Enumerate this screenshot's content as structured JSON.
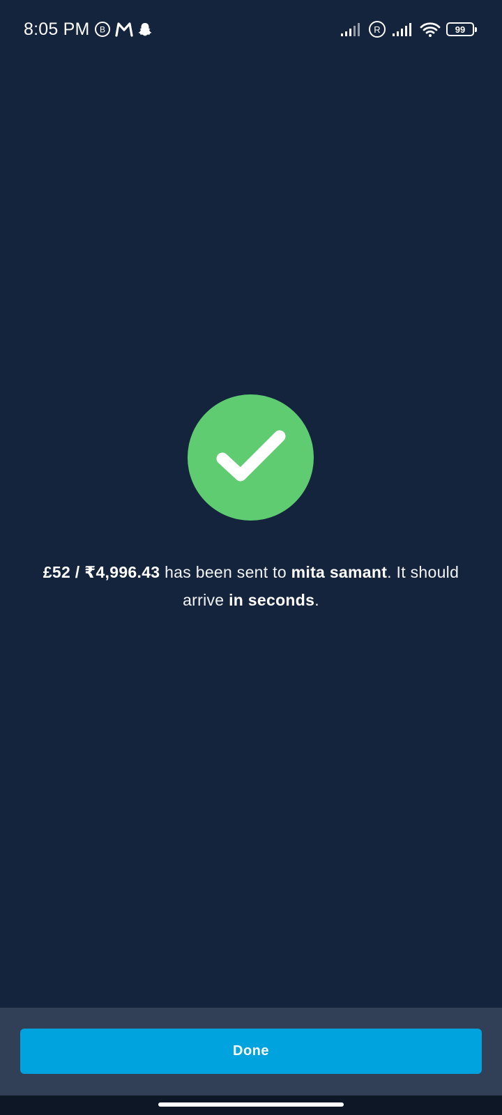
{
  "status_bar": {
    "time": "8:05 PM",
    "battery": "99",
    "icons": [
      "b-circle-icon",
      "m-logo-icon",
      "snapchat-ghost-icon",
      "signal-icon",
      "registered-icon",
      "signal-icon",
      "wifi-icon",
      "battery-icon"
    ]
  },
  "success": {
    "icon": "checkmark-icon",
    "color": "#5fcc72"
  },
  "message": {
    "amount": "£52 / ₹4,996.43",
    "sent_text": " has been sent to ",
    "recipient": "mita samant",
    "arrive_text": ". It should arrive ",
    "timing": "in seconds",
    "end": "."
  },
  "footer": {
    "done_label": "Done",
    "button_color": "#00a3de"
  }
}
